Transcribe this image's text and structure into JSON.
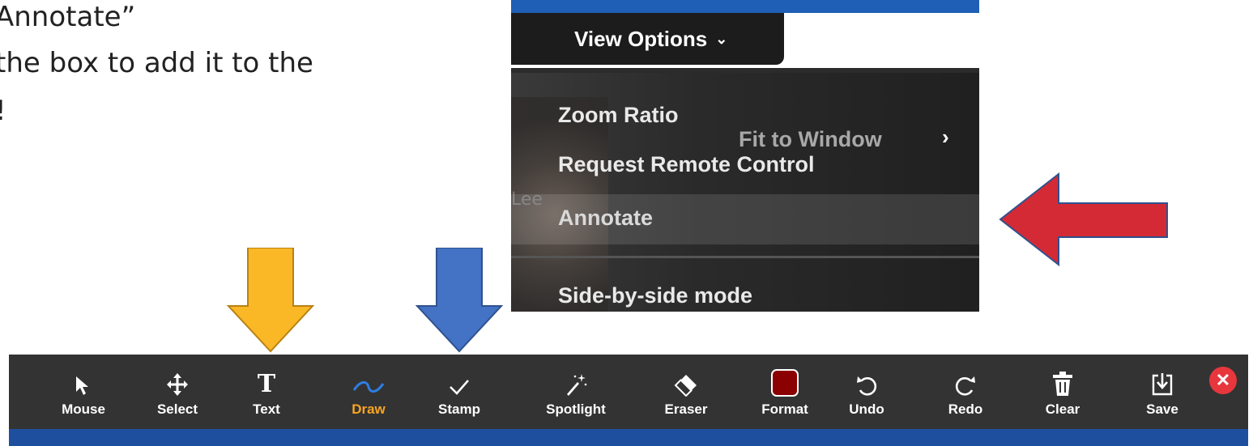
{
  "instructions": {
    "line1": "Annotate”",
    "line2": "the box to add it to the",
    "line3": "!"
  },
  "menu": {
    "button_label": "View Options",
    "button_chevron": "⌄",
    "items": [
      {
        "label": "Zoom Ratio",
        "value": "Fit to Window",
        "arrow": "›"
      },
      {
        "label": "Request Remote Control"
      },
      {
        "label": "Annotate"
      },
      {
        "label": "Side-by-side mode"
      }
    ],
    "video_name": "Lee"
  },
  "arrows": {
    "text_arrow_color": "#fbb826",
    "stamp_arrow_color": "#4472c4",
    "annotate_arrow_color": "#d42a35"
  },
  "toolbar": {
    "tools": [
      {
        "label": "Mouse",
        "icon": "cursor-icon"
      },
      {
        "label": "Select",
        "icon": "move-icon"
      },
      {
        "label": "Text",
        "icon": "text-icon"
      },
      {
        "label": "Draw",
        "icon": "draw-wave-icon",
        "active": true
      },
      {
        "label": "Stamp",
        "icon": "checkmark-icon"
      },
      {
        "label": "Spotlight",
        "icon": "magic-wand-icon"
      },
      {
        "label": "Eraser",
        "icon": "eraser-icon"
      },
      {
        "label": "Format",
        "icon": "color-swatch-icon"
      },
      {
        "label": "Undo",
        "icon": "undo-icon"
      },
      {
        "label": "Redo",
        "icon": "redo-icon"
      },
      {
        "label": "Clear",
        "icon": "trash-icon"
      },
      {
        "label": "Save",
        "icon": "download-icon"
      }
    ],
    "close_glyph": "✕",
    "format_color": "#8b0000",
    "draw_color": "#2e7de1",
    "active_color": "#f6a623",
    "bar_color": "#333333",
    "bottom_color": "#1e4f9f"
  }
}
